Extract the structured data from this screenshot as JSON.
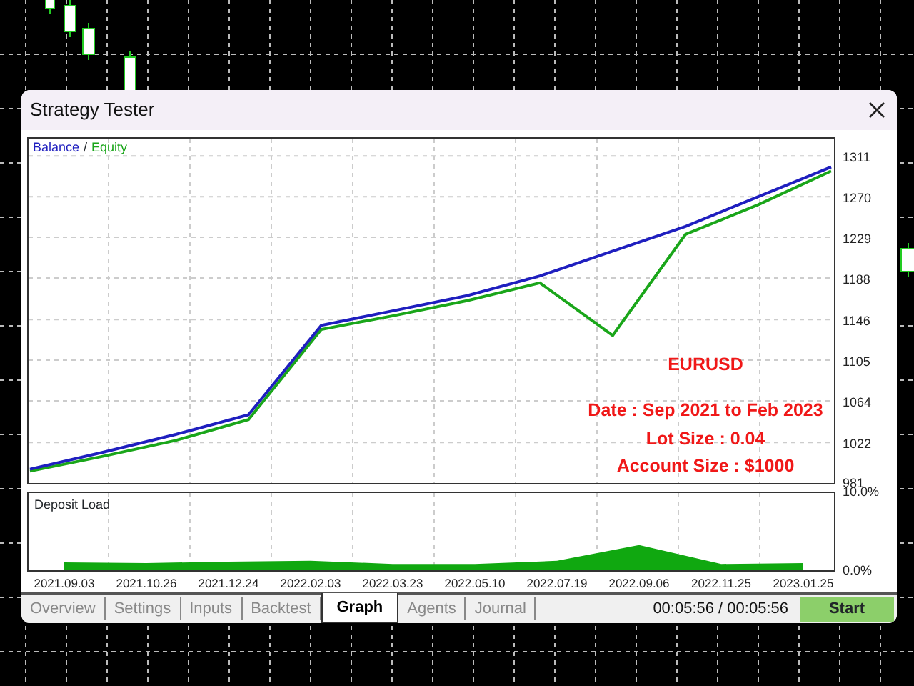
{
  "window": {
    "title": "Strategy Tester"
  },
  "balance_chart": {
    "legend_separator": "/",
    "chart_data": {
      "type": "line",
      "grid": true,
      "ylim": [
        981,
        1330
      ],
      "yticks": [
        981,
        1022,
        1064,
        1105,
        1146,
        1188,
        1229,
        1270,
        1311
      ],
      "series": [
        {
          "name": "Balance",
          "color": "#1f1fbf",
          "values": [
            995,
            1012,
            1030,
            1050,
            1140,
            1155,
            1170,
            1190,
            1215,
            1240,
            1270,
            1300
          ]
        },
        {
          "name": "Equity",
          "color": "#1aa61a",
          "values": [
            993,
            1008,
            1024,
            1045,
            1136,
            1150,
            1165,
            1183,
            1130,
            1232,
            1262,
            1296
          ]
        }
      ],
      "annotations": [
        "EURUSD",
        "Date : Sep 2021 to Feb 2023",
        "Lot Size : 0.04",
        "Account Size : $1000"
      ]
    }
  },
  "deposit_load": {
    "chart_data": {
      "type": "area",
      "grid": true,
      "ylim": [
        0,
        10
      ],
      "yticks": [
        {
          "value": 0,
          "label": "0.0%"
        },
        {
          "value": 10,
          "label": "10.0%"
        }
      ],
      "categories": [
        "2021.09.03",
        "2021.10.26",
        "2021.12.24",
        "2022.02.03",
        "2022.03.23",
        "2022.05.10",
        "2022.07.19",
        "2022.09.06",
        "2022.11.25",
        "2023.01.25"
      ],
      "series": [
        {
          "name": "Deposit Load",
          "color": "#10a810",
          "values": [
            1.0,
            0.9,
            1.1,
            1.2,
            0.8,
            0.8,
            1.2,
            3.2,
            0.8,
            0.9
          ]
        }
      ]
    }
  },
  "tabs": [
    {
      "label": "Overview",
      "selected": false
    },
    {
      "label": "Settings",
      "selected": false
    },
    {
      "label": "Inputs",
      "selected": false
    },
    {
      "label": "Backtest",
      "selected": false
    },
    {
      "label": "Graph",
      "selected": true
    },
    {
      "label": "Agents",
      "selected": false
    },
    {
      "label": "Journal",
      "selected": false
    }
  ],
  "timer": "00:05:56 / 00:05:56",
  "start_button": "Start"
}
